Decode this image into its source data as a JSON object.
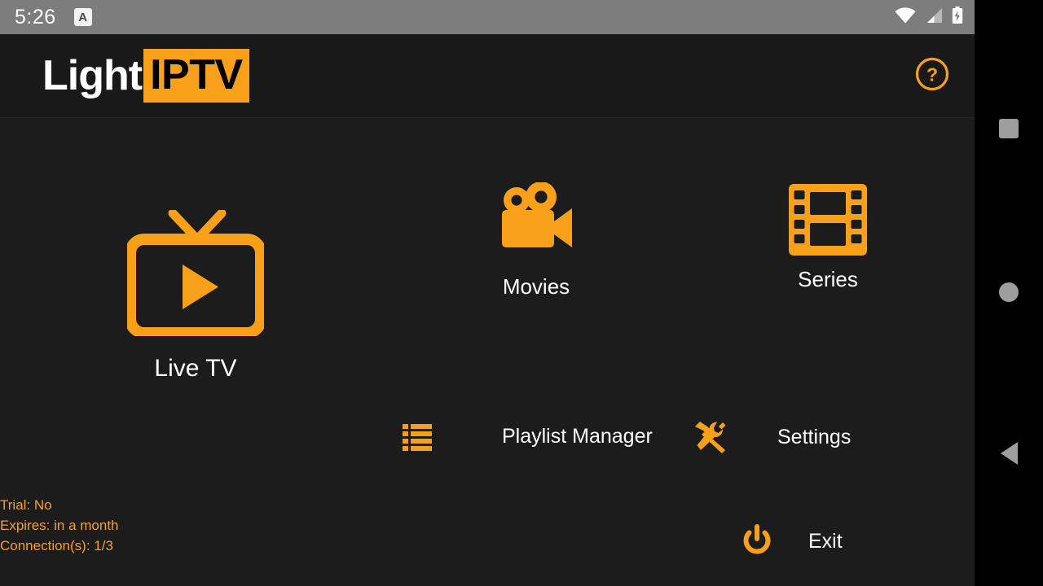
{
  "theme": {
    "accent": "#f9a01b",
    "background": "#1c1c1c",
    "header_background": "#191919",
    "status_bar_background": "#7d7d7d",
    "nav_bar_background": "#000000",
    "text_primary": "#ffffff"
  },
  "status_bar": {
    "clock": "5:26",
    "input_indicator": "A",
    "icons": [
      "wifi-icon",
      "cellular-signal-icon",
      "battery-charging-icon"
    ]
  },
  "header": {
    "logo_part1": "Light",
    "logo_part2": "IPTV",
    "help_icon": "help-circle-icon"
  },
  "main": {
    "tiles": [
      {
        "id": "live-tv",
        "label": "Live TV",
        "icon": "tv-play-icon"
      },
      {
        "id": "movies",
        "label": "Movies",
        "icon": "movie-camera-icon"
      },
      {
        "id": "series",
        "label": "Series",
        "icon": "film-strip-icon"
      }
    ],
    "secondary": [
      {
        "id": "playlist-manager",
        "label": "Playlist Manager",
        "icon": "list-icon"
      },
      {
        "id": "settings",
        "label": "Settings",
        "icon": "tools-icon"
      }
    ],
    "exit": {
      "label": "Exit",
      "icon": "power-icon"
    }
  },
  "account": {
    "trial": "Trial: No",
    "expires": "Expires: in a month",
    "connections": "Connection(s): 1/3"
  },
  "nav_bar": {
    "recents": "recents-square-icon",
    "home": "home-circle-icon",
    "back": "back-triangle-icon"
  }
}
